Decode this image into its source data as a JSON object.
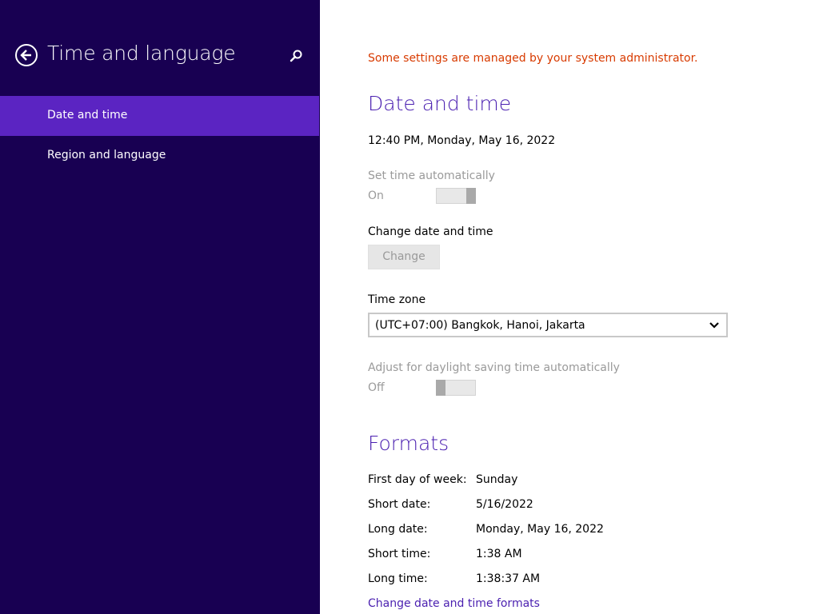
{
  "sidebar": {
    "title": "Time and language",
    "items": [
      {
        "label": "Date and time",
        "selected": true
      },
      {
        "label": "Region and language",
        "selected": false
      }
    ],
    "bg_color": "#180052",
    "selected_color": "#5b24c2"
  },
  "main": {
    "admin_notice": "Some settings are managed by your system administrator.",
    "date_time": {
      "heading": "Date and time",
      "current": "12:40 PM, Monday, May 16, 2022",
      "set_auto_label": "Set time automatically",
      "set_auto_state": "On",
      "change_label": "Change date and time",
      "change_button": "Change",
      "timezone_label": "Time zone",
      "timezone_value": "(UTC+07:00) Bangkok, Hanoi, Jakarta",
      "dst_label": "Adjust for daylight saving time automatically",
      "dst_state": "Off"
    },
    "formats": {
      "heading": "Formats",
      "rows": [
        {
          "label": "First day of week:",
          "value": "Sunday"
        },
        {
          "label": "Short date:",
          "value": "5/16/2022"
        },
        {
          "label": "Long date:",
          "value": "Monday, May 16, 2022"
        },
        {
          "label": "Short time:",
          "value": "1:38 AM"
        },
        {
          "label": "Long time:",
          "value": "1:38:37 AM"
        }
      ],
      "change_link": "Change date and time formats"
    }
  },
  "icons": {
    "back": "back-arrow-icon",
    "search": "search-icon",
    "dropdown": "chevron-down-icon"
  },
  "colors": {
    "accent": "#4a1fb0",
    "notice": "#d83b01",
    "disabled_text": "#9a9a9a"
  }
}
